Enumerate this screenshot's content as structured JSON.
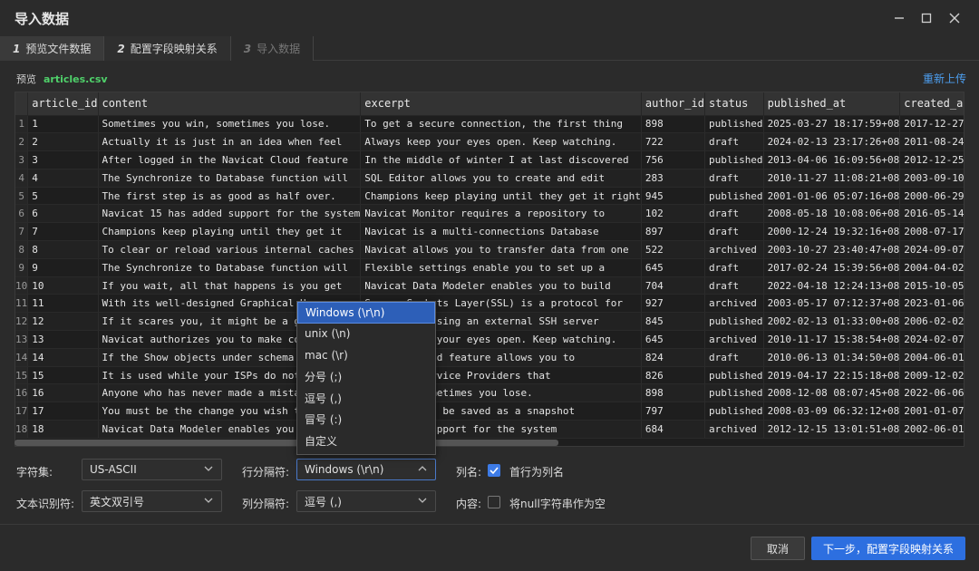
{
  "window": {
    "title": "导入数据"
  },
  "tabs": [
    {
      "num": "1",
      "label": "预览文件数据"
    },
    {
      "num": "2",
      "label": "配置字段映射关系"
    },
    {
      "num": "3",
      "label": "导入数据"
    }
  ],
  "preview": {
    "label": "预览",
    "filename": "articles.csv",
    "reupload": "重新上传"
  },
  "table": {
    "columns": [
      "article_id",
      "content",
      "excerpt",
      "author_id",
      "status",
      "published_at",
      "created_at"
    ],
    "rows": [
      [
        "1",
        "1",
        "Sometimes you win, sometimes you lose.",
        "To get a secure connection, the first thing",
        "898",
        "published",
        "2025-03-27 18:17:59+08",
        "2017-12-27 20:"
      ],
      [
        "2",
        "2",
        "Actually it is just in an idea when feel",
        "Always keep your eyes open. Keep watching.",
        "722",
        "draft",
        "2024-02-13 23:17:26+08",
        "2011-08-24 18:"
      ],
      [
        "3",
        "3",
        "After logged in the Navicat Cloud feature",
        "In the middle of winter I at last discovered",
        "756",
        "published",
        "2013-04-06 16:09:56+08",
        "2012-12-25 22:"
      ],
      [
        "4",
        "4",
        "The Synchronize to Database function will",
        "SQL Editor allows you to create and edit",
        "283",
        "draft",
        "2010-11-27 11:08:21+08",
        "2003-09-10 09:"
      ],
      [
        "5",
        "5",
        "The first step is as good as half over.",
        "Champions keep playing until they get it right",
        "945",
        "published",
        "2001-01-06 05:07:16+08",
        "2000-06-29 21:"
      ],
      [
        "6",
        "6",
        "Navicat 15 has added support for the system",
        "Navicat Monitor requires a repository to",
        "102",
        "draft",
        "2008-05-18 10:08:06+08",
        "2016-05-14 19:"
      ],
      [
        "7",
        "7",
        "Champions keep playing until they get it",
        "Navicat is a multi-connections Database",
        "897",
        "draft",
        "2000-12-24 19:32:16+08",
        "2008-07-17 01:"
      ],
      [
        "8",
        "8",
        "To clear or reload various internal caches",
        "Navicat allows you to transfer data from one",
        "522",
        "archived",
        "2003-10-27 23:40:47+08",
        "2024-09-07 14:"
      ],
      [
        "9",
        "9",
        "The Synchronize to Database function will",
        "Flexible settings enable you to set up a",
        "645",
        "draft",
        "2017-02-24 15:39:56+08",
        "2004-04-02 09:"
      ],
      [
        "10",
        "10",
        "If you wait, all that happens is you get",
        "Navicat Data Modeler enables you to build",
        "704",
        "draft",
        "2022-04-18 12:24:13+08",
        "2015-10-05 21:"
      ],
      [
        "11",
        "11",
        "With its well-designed Graphical User",
        "Secure Sockets Layer(SSL) is a protocol for",
        "927",
        "archived",
        "2003-05-17 07:12:37+08",
        "2023-01-06 22:"
      ],
      [
        "12",
        "12",
        "If it scares you, it might be a good thing",
        "Connection using an external SSH server",
        "845",
        "published",
        "2002-02-13 01:33:00+08",
        "2006-02-02 17:"
      ],
      [
        "13",
        "13",
        "Navicat authorizes you to make connection",
        "Always keep your eyes open. Keep watching.",
        "645",
        "archived",
        "2010-11-17 15:38:54+08",
        "2024-02-07 01:"
      ],
      [
        "14",
        "14",
        "If the Show objects under schema in",
        "Navicat Cloud feature allows you to",
        "824",
        "draft",
        "2010-06-13 01:34:50+08",
        "2004-06-01 16:"
      ],
      [
        "15",
        "15",
        "It is used while your ISPs do not allow",
        "Internet Service Providers that",
        "826",
        "published",
        "2019-04-17 22:15:18+08",
        "2009-12-02 09:"
      ],
      [
        "16",
        "16",
        "Anyone who has never made a mistake has",
        "You win, sometimes you lose.",
        "898",
        "published",
        "2008-12-08 08:07:45+08",
        "2022-06-06 10:"
      ],
      [
        "17",
        "17",
        "You must be the change you wish to see",
        "Database can be saved as a snapshot",
        "797",
        "published",
        "2008-03-09 06:32:12+08",
        "2001-01-07 00:"
      ],
      [
        "18",
        "18",
        "Navicat Data Modeler enables you to build",
        "has added support for the system",
        "684",
        "archived",
        "2012-12-15 13:01:51+08",
        "2002-06-01 00:"
      ]
    ]
  },
  "form": {
    "charset_label": "字符集:",
    "charset_value": "US-ASCII",
    "row_sep_label": "行分隔符:",
    "row_sep_value": "Windows (\\r\\n)",
    "colname_label": "列名:",
    "colname_checkbox_label": "首行为列名",
    "text_qualifier_label": "文本识别符:",
    "text_qualifier_value": "英文双引号",
    "col_sep_label": "列分隔符:",
    "col_sep_value": "逗号 (,)",
    "content_label": "内容:",
    "null_checkbox_label": "将null字符串作为空"
  },
  "row_sep_options": [
    "Windows (\\r\\n)",
    "unix (\\n)",
    "mac (\\r)",
    "分号 (;)",
    "逗号 (,)",
    "冒号 (:)",
    "自定义"
  ],
  "footer": {
    "cancel": "取消",
    "next": "下一步，配置字段映射关系"
  },
  "colors": {
    "accent": "#2d6fe0",
    "filename": "#4fd06a",
    "link": "#4d9ff0"
  }
}
